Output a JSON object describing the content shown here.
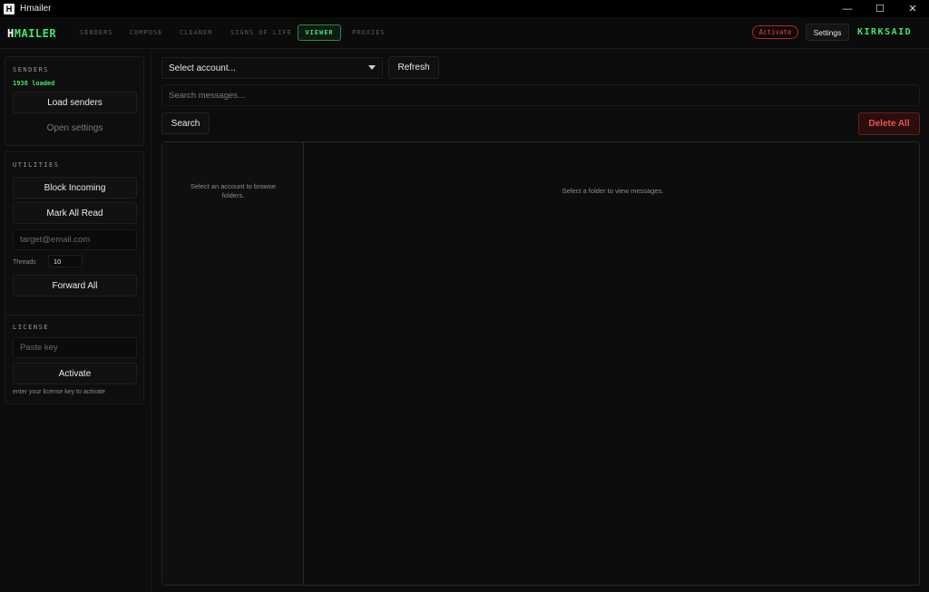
{
  "window": {
    "title": "Hmailer",
    "icon_letter": "H",
    "controls": {
      "minimize": "—",
      "maximize": "☐",
      "close": "✕"
    }
  },
  "nav": {
    "brand_prefix": "H",
    "brand_rest": "MAILER",
    "tabs": [
      {
        "label": "SENDERS",
        "active": false
      },
      {
        "label": "COMPOSE",
        "active": false
      },
      {
        "label": "CLEANER",
        "active": false
      },
      {
        "label": "SIGNS OF LIFE",
        "active": false
      },
      {
        "label": "VIEWER",
        "active": true
      },
      {
        "label": "PROXIES",
        "active": false
      }
    ],
    "activate_label": "Activate",
    "settings_label": "Settings",
    "username": "KIRKSAID"
  },
  "sidebar": {
    "senders": {
      "title": "SENDERS",
      "loaded_text": "1938 loaded",
      "load_button": "Load senders",
      "settings_link": "Open settings"
    },
    "utilities": {
      "title": "UTILITIES",
      "block_button": "Block Incoming",
      "mark_read_button": "Mark All Read",
      "target_placeholder": "target@email.com",
      "threads_label": "Threads",
      "threads_value": "10",
      "forward_button": "Forward All"
    },
    "license": {
      "title": "LICENSE",
      "key_placeholder": "Paste key",
      "activate_button": "Activate",
      "hint": "enter your license key to activate"
    }
  },
  "main": {
    "account_select": "Select account...",
    "refresh_button": "Refresh",
    "search_placeholder": "Search messages...",
    "search_button": "Search",
    "delete_all_button": "Delete All",
    "folders_empty": "Select an account to browse folders.",
    "messages_empty": "Select a folder to view messages."
  },
  "colors": {
    "accent": "#3fe66b",
    "danger": "#ef3c3c",
    "background": "#0c0c0c"
  }
}
